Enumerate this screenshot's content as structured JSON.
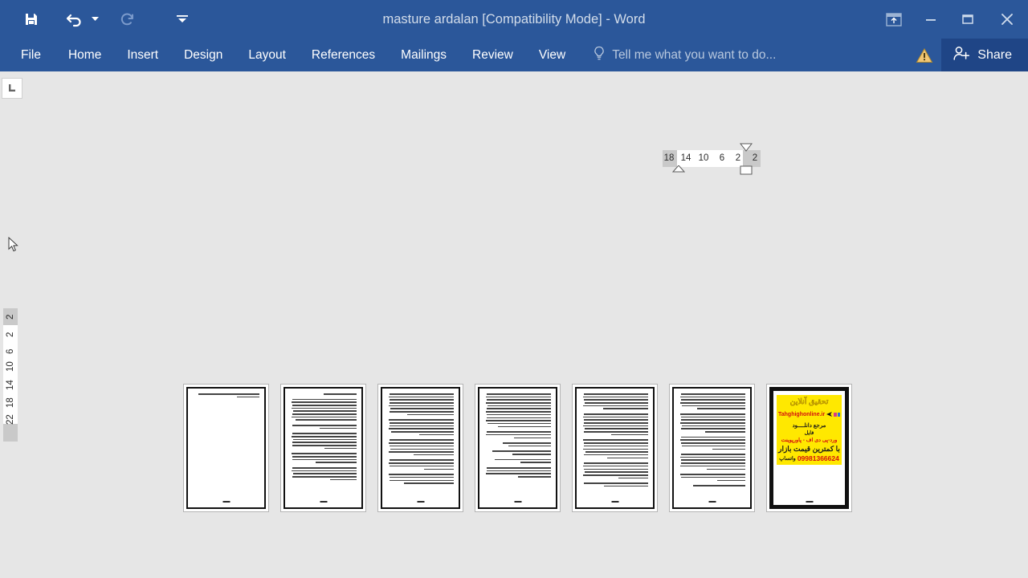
{
  "window": {
    "title": "masture ardalan [Compatibility Mode] - Word",
    "accent_color": "#2b579a",
    "share_bg": "#1f4586"
  },
  "quick_access": {
    "items": [
      {
        "name": "save-icon",
        "label": "Save",
        "enabled": "true"
      },
      {
        "name": "undo-icon",
        "label": "Undo",
        "enabled": "true"
      },
      {
        "name": "undo-dropdown-icon",
        "label": "Undo options",
        "enabled": "true"
      },
      {
        "name": "redo-icon",
        "label": "Repeat",
        "enabled": "false"
      },
      {
        "name": "customize-qat-icon",
        "label": "Customize Quick Access Toolbar",
        "enabled": "true"
      }
    ]
  },
  "window_controls": [
    {
      "name": "ribbon-display-options-icon",
      "label": "Ribbon Display Options"
    },
    {
      "name": "minimize-icon",
      "label": "Minimize"
    },
    {
      "name": "restore-icon",
      "label": "Restore Down"
    },
    {
      "name": "close-icon",
      "label": "Close"
    }
  ],
  "ribbon": {
    "tabs": [
      {
        "label": "File"
      },
      {
        "label": "Home"
      },
      {
        "label": "Insert"
      },
      {
        "label": "Design"
      },
      {
        "label": "Layout"
      },
      {
        "label": "References"
      },
      {
        "label": "Mailings"
      },
      {
        "label": "Review"
      },
      {
        "label": "View"
      }
    ],
    "tell_me": "Tell me what you want to do...",
    "tell_me_icon": "lightbulb-icon",
    "warning_icon": "warning-triangle-icon",
    "share_label": "Share",
    "share_icon": "person-add-icon"
  },
  "rulers": {
    "tab_stop_marker": "left-tab-stop",
    "horizontal_numbers": [
      "18",
      "14",
      "10",
      "6",
      "2",
      "2"
    ],
    "vertical_numbers": [
      "2",
      "2",
      "6",
      "10",
      "14",
      "18",
      "22"
    ]
  },
  "document": {
    "page_count": 7,
    "pages": [
      {
        "index": 1,
        "type": "text",
        "density": "sparse"
      },
      {
        "index": 2,
        "type": "text",
        "density": "full"
      },
      {
        "index": 3,
        "type": "text",
        "density": "full"
      },
      {
        "index": 4,
        "type": "text",
        "density": "full"
      },
      {
        "index": 5,
        "type": "text",
        "density": "full"
      },
      {
        "index": 6,
        "type": "text",
        "density": "full"
      },
      {
        "index": 7,
        "type": "advertisement",
        "density": "none"
      }
    ],
    "ad_page": {
      "logo": "تحقیق آنلاین",
      "website": "Tahghighonline.ir",
      "reference": "مرجع دانلــــود",
      "file_word": "فایل",
      "formats": "ورد-پی دی اف - پاورپوینت",
      "price_text": "با کمترین قیمت بازار",
      "phone": "09981366624",
      "whatsapp": "واتساپ",
      "bg_color": "#ffe800",
      "accent_red": "#d41010"
    }
  }
}
